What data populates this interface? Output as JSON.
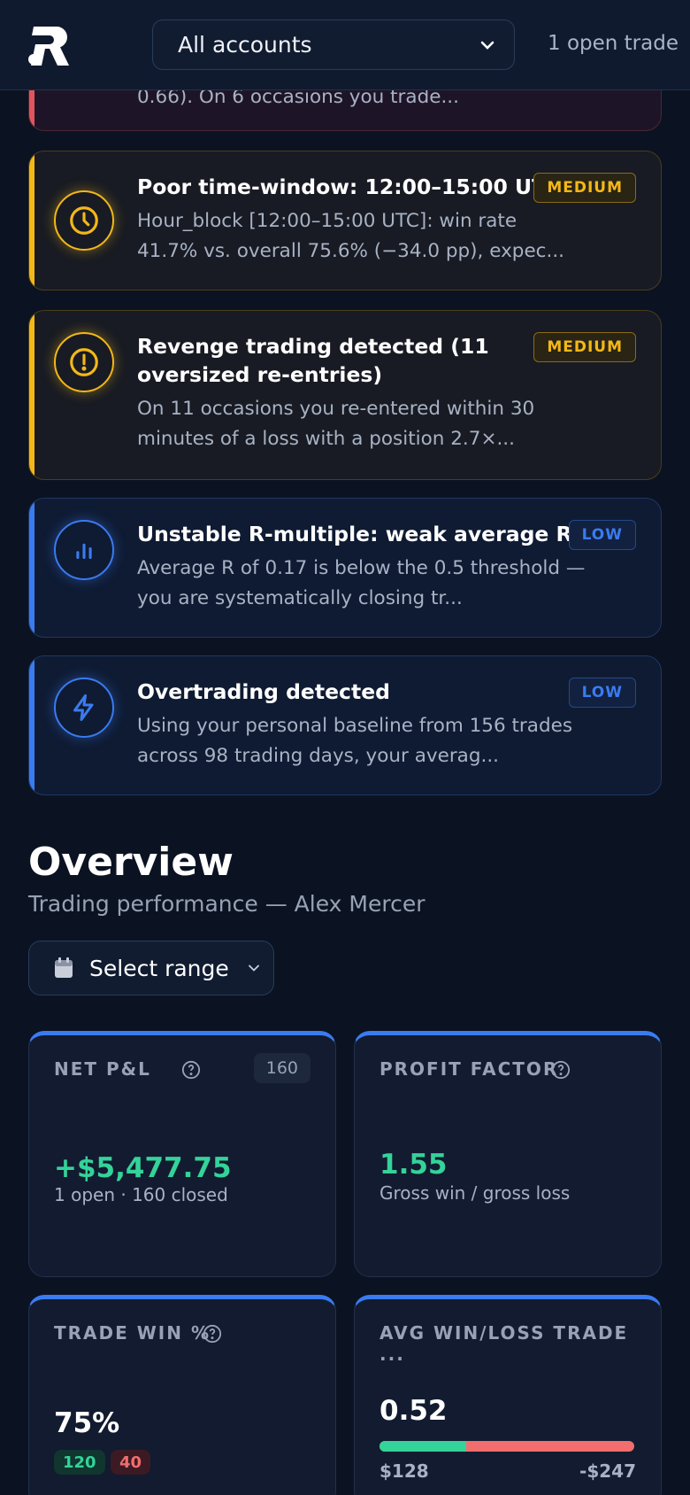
{
  "header": {
    "account_select": "All accounts",
    "open_trade": "1 open trade"
  },
  "alerts": [
    {
      "severity": "high",
      "desc_tail": "0.66). On 6 occasions you trade..."
    },
    {
      "severity": "medium",
      "icon": "clock-icon",
      "title": "Poor time-window: 12:00–15:00 UTC",
      "badge": "MEDIUM",
      "desc_line1": "Hour_block [12:00–15:00 UTC]: win rate",
      "desc_line2": "41.7% vs. overall 75.6% (−34.0 pp), expec..."
    },
    {
      "severity": "medium",
      "icon": "alert-circle-icon",
      "title_line1": "Revenge trading detected (11",
      "title_line2": "oversized re-entries)",
      "badge": "MEDIUM",
      "desc_line1": "On 11 occasions you re-entered within 30",
      "desc_line2": "minutes of a loss with a position 2.7×..."
    },
    {
      "severity": "low",
      "icon": "bar-chart-icon",
      "title": "Unstable R-multiple: weak average R",
      "badge": "LOW",
      "desc_line1": "Average R of 0.17 is below the 0.5 threshold —",
      "desc_line2": "you are systematically closing tr..."
    },
    {
      "severity": "low",
      "icon": "lightning-icon",
      "title": "Overtrading detected",
      "badge": "LOW",
      "desc_line1": "Using your personal baseline from 156 trades",
      "desc_line2": "across 98 trading days, your averag..."
    }
  ],
  "overview": {
    "title": "Overview",
    "subtitle": "Trading performance — Alex Mercer",
    "range_button": "Select range"
  },
  "stats": {
    "net_pnl": {
      "label": "NET P&L",
      "count": "160",
      "value": "+$5,477.75",
      "sub": "1 open · 160 closed"
    },
    "profit_factor": {
      "label": "PROFIT FACTOR",
      "value": "1.55",
      "sub": "Gross win / gross loss"
    },
    "trade_win": {
      "label": "TRADE WIN %",
      "value": "75%",
      "wins": "120",
      "losses": "40"
    },
    "avg_win_loss": {
      "label": "AVG WIN/LOSS TRADE ...",
      "value": "0.52",
      "avg_win": "$128",
      "avg_loss": "-$247",
      "win_share": 0.34
    }
  },
  "colors": {
    "accent": "#3a7bf0",
    "medium": "#f3b818",
    "positive": "#34d399",
    "negative": "#f26d6d"
  }
}
